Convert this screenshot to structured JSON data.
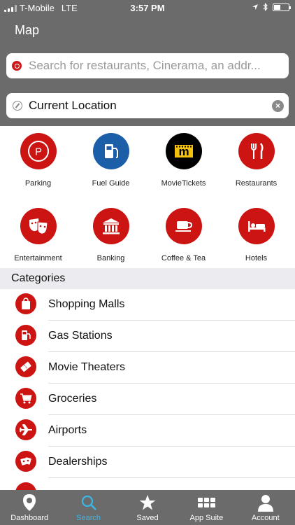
{
  "status_bar": {
    "carrier": "T-Mobile",
    "network": "LTE",
    "time": "3:57 PM",
    "battery_level": 0.4
  },
  "header": {
    "title": "Map"
  },
  "search": {
    "placeholder": "Search for restaurants, Cinerama, an addr..."
  },
  "location": {
    "value": "Current Location"
  },
  "quick_categories": [
    {
      "label": "Parking",
      "icon": "parking-icon",
      "color": "#cc1412"
    },
    {
      "label": "Fuel Guide",
      "icon": "fuel-pump-icon",
      "color": "#1c5ea8"
    },
    {
      "label": "MovieTickets",
      "icon": "movietickets-logo-icon",
      "color": "#000000"
    },
    {
      "label": "Restaurants",
      "icon": "fork-knife-icon",
      "color": "#cc1412"
    },
    {
      "label": "Entertainment",
      "icon": "theater-masks-icon",
      "color": "#cc1412"
    },
    {
      "label": "Banking",
      "icon": "bank-icon",
      "color": "#cc1412"
    },
    {
      "label": "Coffee & Tea",
      "icon": "coffee-cup-icon",
      "color": "#cc1412"
    },
    {
      "label": "Hotels",
      "icon": "bed-icon",
      "color": "#cc1412"
    }
  ],
  "categories": {
    "header": "Categories",
    "items": [
      {
        "label": "Shopping Malls",
        "icon": "shopping-bag-icon"
      },
      {
        "label": "Gas Stations",
        "icon": "gas-pump-icon"
      },
      {
        "label": "Movie Theaters",
        "icon": "ticket-icon"
      },
      {
        "label": "Groceries",
        "icon": "shopping-cart-icon"
      },
      {
        "label": "Airports",
        "icon": "airplane-icon"
      },
      {
        "label": "Dealerships",
        "icon": "car-dealership-icon"
      }
    ]
  },
  "tabbar": {
    "items": [
      {
        "label": "Dashboard",
        "icon": "map-pin-icon",
        "active": false
      },
      {
        "label": "Search",
        "icon": "search-icon",
        "active": true
      },
      {
        "label": "Saved",
        "icon": "star-icon",
        "active": false
      },
      {
        "label": "App Suite",
        "icon": "grid-icon",
        "active": false
      },
      {
        "label": "Account",
        "icon": "person-icon",
        "active": false
      }
    ]
  },
  "colors": {
    "header_bg": "#6b6b6b",
    "brand_red": "#cc1412",
    "fuel_blue": "#1c5ea8",
    "active_tab": "#3ab8e8"
  }
}
